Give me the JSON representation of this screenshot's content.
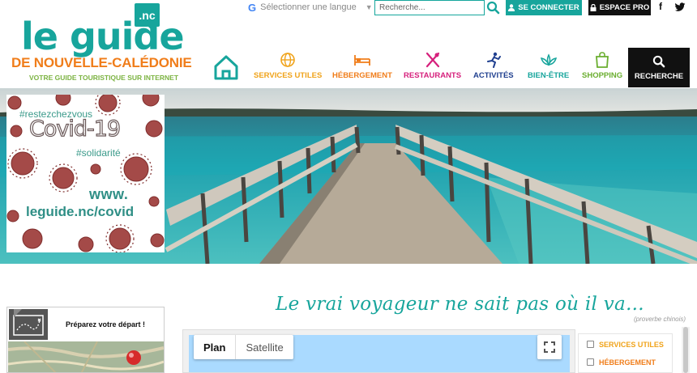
{
  "topbar": {
    "language_label": "Sélectionner une langue",
    "search_placeholder": "Recherche...",
    "connect_label": "SE CONNECTER",
    "pro_label": "ESPACE PRO",
    "facebook": "f"
  },
  "logo": {
    "main": "le guide",
    "tld": ".nc",
    "subtitle": "DE NOUVELLE-CALÉDONIE",
    "tagline": "VOTRE GUIDE TOURISTIQUE SUR INTERNET"
  },
  "nav": {
    "items": [
      {
        "label": "SERVICES UTILES",
        "color": "#f0a31a"
      },
      {
        "label": "HÉBERGEMENT",
        "color": "#f07d1a"
      },
      {
        "label": "RESTAURANTS",
        "color": "#d6207c"
      },
      {
        "label": "ACTIVITÉS",
        "color": "#1f3f8f"
      },
      {
        "label": "BIEN-ÊTRE",
        "color": "#17a59c"
      },
      {
        "label": "SHOPPING",
        "color": "#6aae2f"
      }
    ],
    "search_label": "RECHERCHE",
    "home_color": "#17a59c"
  },
  "covid": {
    "hashtag1": "#restezchezvous",
    "title": "Covid-19",
    "hashtag2": "#solidarité",
    "url_line1": "www.",
    "url_line2": "leguide.nc/covid"
  },
  "quote": {
    "text": "Le vrai voyageur ne sait pas où il va...",
    "source": "(proverbe chinois)"
  },
  "depart": {
    "label": "Préparez votre départ !"
  },
  "map": {
    "tab_plan": "Plan",
    "tab_satellite": "Satellite"
  },
  "filters": [
    {
      "label": "SERVICES UTILES",
      "color": "#f0a31a"
    },
    {
      "label": "HÉBERGEMENT",
      "color": "#f07d1a"
    }
  ],
  "colors": {
    "brand": "#17a59c",
    "orange": "#f07d1a",
    "green": "#7cb342"
  }
}
